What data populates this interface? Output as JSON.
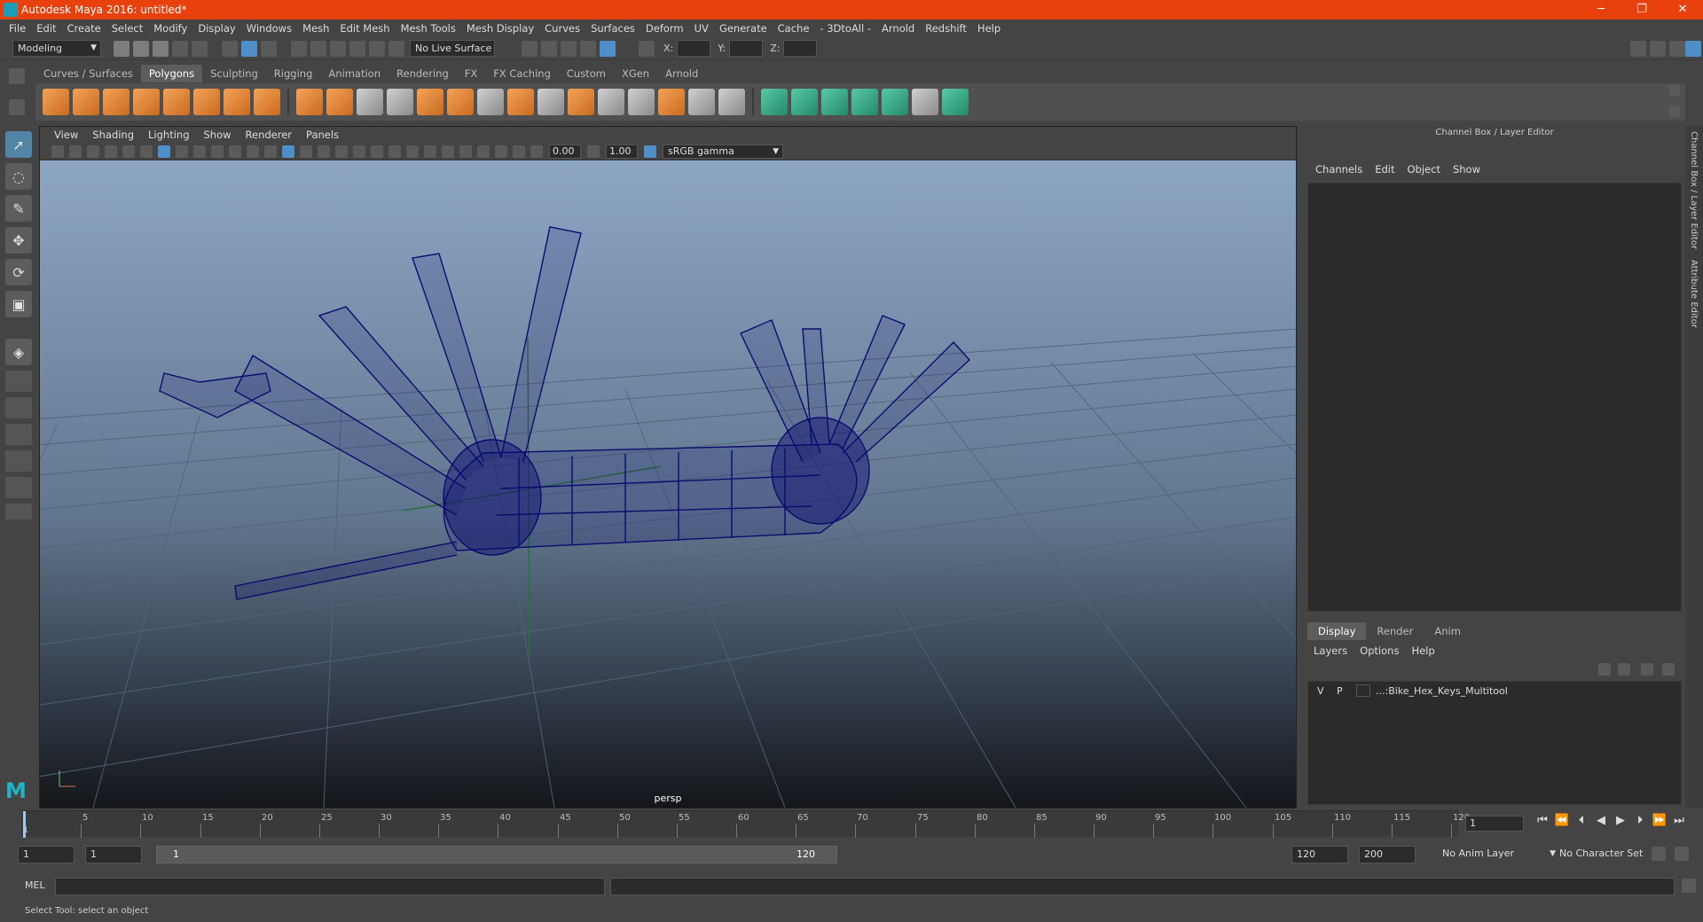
{
  "window": {
    "title": "Autodesk Maya 2016: untitled*",
    "min": "─",
    "max": "❐",
    "close": "✕"
  },
  "menu": [
    "File",
    "Edit",
    "Create",
    "Select",
    "Modify",
    "Display",
    "Windows",
    "Mesh",
    "Edit Mesh",
    "Mesh Tools",
    "Mesh Display",
    "Curves",
    "Surfaces",
    "Deform",
    "UV",
    "Generate",
    "Cache",
    "- 3DtoAll -",
    "Arnold",
    "Redshift",
    "Help"
  ],
  "status": {
    "mode": "Modeling",
    "live_surface": "No Live Surface",
    "x_label": "X:",
    "y_label": "Y:",
    "z_label": "Z:"
  },
  "shelf_tabs": [
    "Curves / Surfaces",
    "Polygons",
    "Sculpting",
    "Rigging",
    "Animation",
    "Rendering",
    "FX",
    "FX Caching",
    "Custom",
    "XGen",
    "Arnold"
  ],
  "shelf_active": "Polygons",
  "viewport": {
    "menu": [
      "View",
      "Shading",
      "Lighting",
      "Show",
      "Renderer",
      "Panels"
    ],
    "exposure": "0.00",
    "gamma_value": "1.00",
    "color_space": "sRGB gamma",
    "camera": "persp"
  },
  "channel_box": {
    "title": "Channel Box / Layer Editor",
    "menu": [
      "Channels",
      "Edit",
      "Object",
      "Show"
    ]
  },
  "layer_editor": {
    "tabs": [
      "Display",
      "Render",
      "Anim"
    ],
    "menu": [
      "Layers",
      "Options",
      "Help"
    ],
    "layer": {
      "v": "V",
      "p": "P",
      "name": "...:Bike_Hex_Keys_Multitool"
    }
  },
  "side_tabs": [
    "Channel Box / Layer Editor",
    "Attribute Editor"
  ],
  "timeline": {
    "ticks": [
      5,
      10,
      15,
      20,
      25,
      30,
      35,
      40,
      45,
      50,
      55,
      60,
      65,
      70,
      75,
      80,
      85,
      90,
      95,
      100,
      105,
      110,
      115,
      120
    ],
    "start_label": "1",
    "current_frame": "1"
  },
  "range": {
    "start": "1",
    "start2": "1",
    "slider_lo": "1",
    "slider_hi": "120",
    "end": "120",
    "end2": "200",
    "anim_layer": "No Anim Layer",
    "char_set": "No Character Set"
  },
  "cmd": {
    "label": "MEL"
  },
  "help": {
    "text": "Select Tool: select an object"
  },
  "colors": {
    "title_bar": "#e8410d",
    "wire": "#0b0b6e",
    "accent": "#5285a6"
  }
}
